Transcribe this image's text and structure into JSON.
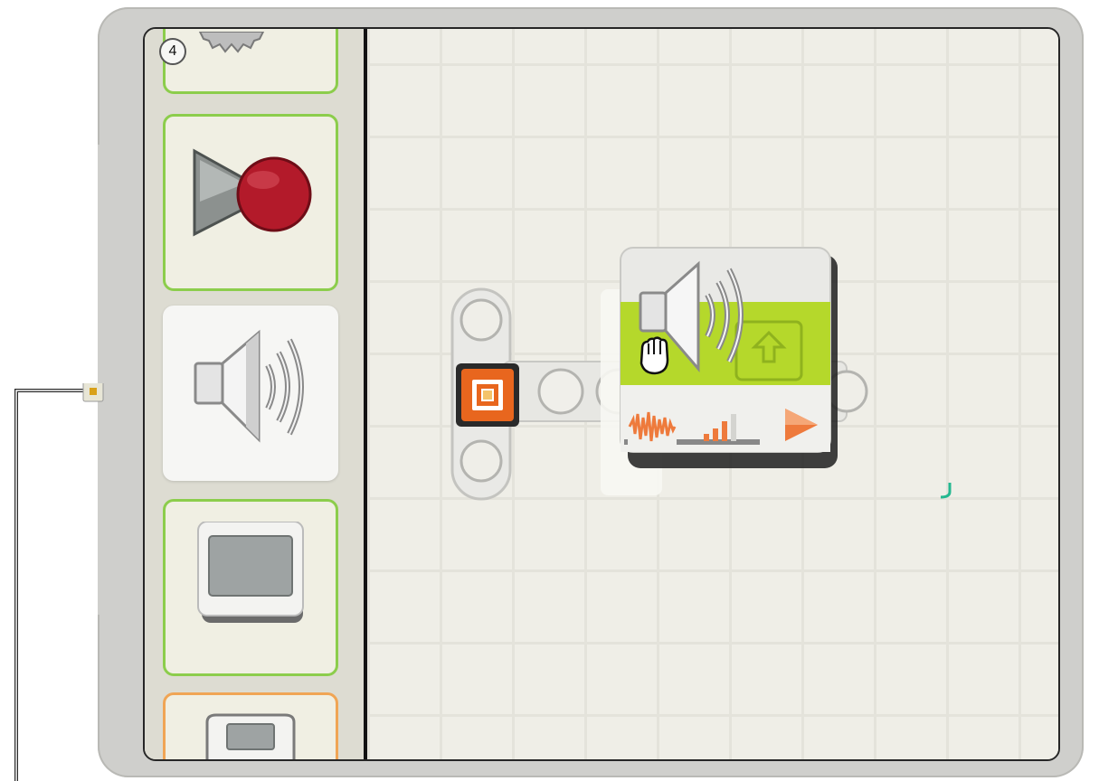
{
  "palette": {
    "badge_number": "4",
    "blocks": [
      {
        "name": "move-block",
        "icon": "gear-icon",
        "border": "green"
      },
      {
        "name": "record-play-block",
        "icon": "record-play-icon",
        "border": "green"
      },
      {
        "name": "sound-block",
        "icon": "speaker-icon",
        "state": "selected"
      },
      {
        "name": "display-block",
        "icon": "display-icon",
        "border": "green"
      },
      {
        "name": "send-message-block",
        "icon": "nxt-brick-icon",
        "border": "orange"
      }
    ]
  },
  "canvas": {
    "sequence_start_icon": "start-icon",
    "dragged_block": {
      "icon": "speaker-icon",
      "hub_icons": [
        "sound-wave-icon",
        "volume-icon",
        "play-icon"
      ],
      "cursor": "grab-hand-cursor"
    }
  },
  "colors": {
    "accent_green": "#b5d82b",
    "palette_green_border": "#8ccd4c",
    "palette_orange_border": "#f0a555",
    "hub_orange": "#ee7a3c",
    "record_red": "#b31a2a",
    "start_orange": "#e8661e"
  }
}
